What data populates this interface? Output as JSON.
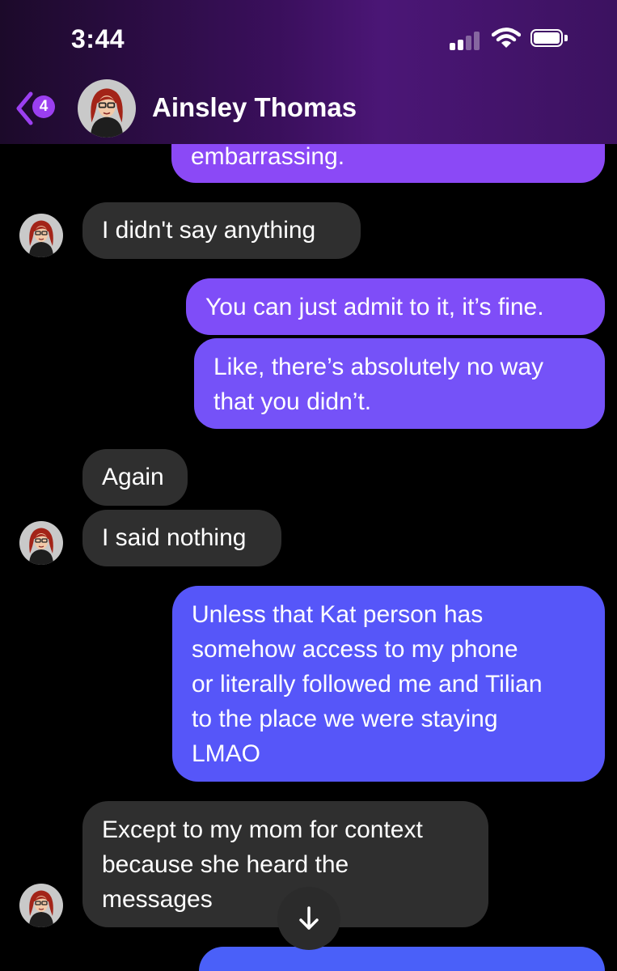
{
  "status_bar": {
    "time": "3:44"
  },
  "header": {
    "unread_count": "4",
    "contact_name": "Ainsley Thomas"
  },
  "messages": [
    {
      "direction": "out",
      "text": "embarrassing."
    },
    {
      "direction": "in",
      "text": "I didn't say anything"
    },
    {
      "direction": "out",
      "text": "You can just admit to it, it’s fine."
    },
    {
      "direction": "out",
      "lines": [
        "Like, there’s absolutely no way",
        "that you didn’t."
      ]
    },
    {
      "direction": "in",
      "text": "Again"
    },
    {
      "direction": "in",
      "text": "I said nothing"
    },
    {
      "direction": "out",
      "lines": [
        "Unless that Kat person has",
        "somehow access to my phone",
        "or literally followed me and Tilian",
        "to the place we were staying",
        "LMAO"
      ]
    },
    {
      "direction": "in",
      "lines": [
        "Except to my mom for context",
        "because she heard the",
        "messages"
      ]
    }
  ],
  "colors": {
    "bubble_in": "#2f2f2f",
    "bubble_out_purple": "#8a4af7",
    "bubble_out_blue": "#4d5cf9",
    "badge": "#9b3ff0"
  },
  "icons": {
    "back": "chevron-left-icon",
    "scroll_down": "arrow-down-icon"
  }
}
